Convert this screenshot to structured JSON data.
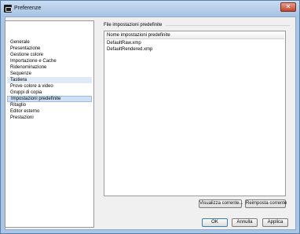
{
  "window": {
    "title": "Preferenze",
    "close_symbol": "✕"
  },
  "sidebar": {
    "items": [
      {
        "label": "Generale",
        "state": "normal"
      },
      {
        "label": "Presentazione",
        "state": "normal"
      },
      {
        "label": "Gestione colore",
        "state": "normal"
      },
      {
        "label": "Importazione e Cache",
        "state": "normal"
      },
      {
        "label": "Ridenominazione",
        "state": "normal"
      },
      {
        "label": "Sequenze",
        "state": "normal"
      },
      {
        "label": "Tastiera",
        "state": "hover"
      },
      {
        "label": "Prove colore a video",
        "state": "normal"
      },
      {
        "label": "Gruppi di copia",
        "state": "normal"
      },
      {
        "label": "Impostazioni predefinite",
        "state": "selected"
      },
      {
        "label": "Ritaglio",
        "state": "normal"
      },
      {
        "label": "Editor esterno",
        "state": "normal"
      },
      {
        "label": "Prestazioni",
        "state": "normal"
      }
    ]
  },
  "main": {
    "group_label": "File impostazioni predefinite",
    "list": {
      "header": "Nome impostazioni predefinite",
      "rows": [
        "DefaultRaw.xmp",
        "DefaultRendered.xmp"
      ]
    },
    "view_button": "Visualizza corrente...",
    "reset_button": "Reimposta corrente"
  },
  "footer": {
    "ok": "OK",
    "cancel": "Annulla",
    "apply": "Applica"
  },
  "colors": {
    "title_bar": "#a9c6e6",
    "selection": "#cfe0f4",
    "hover": "#dfeaf6",
    "close_button": "#c2452c"
  }
}
